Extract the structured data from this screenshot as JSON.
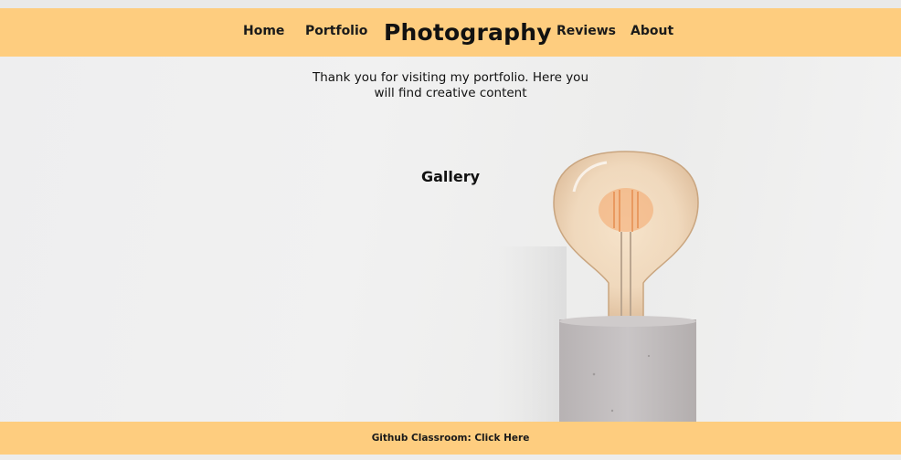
{
  "header": {
    "nav_left": [
      "Home",
      "Portfolio"
    ],
    "brand": "Photography",
    "nav_right": [
      "Reviews",
      "About"
    ]
  },
  "intro": {
    "line1": "Thank you for visiting my portfolio. Here you",
    "line2": "will find creative content"
  },
  "gallery": {
    "title": "Gallery"
  },
  "footer": {
    "link_text": "Github Classroom: Click Here"
  },
  "colors": {
    "accent": "#fecd7f",
    "background": "#efefef",
    "text": "#111111"
  },
  "icons": {
    "hero_image": "lightbulb-on-concrete-base-photo"
  }
}
